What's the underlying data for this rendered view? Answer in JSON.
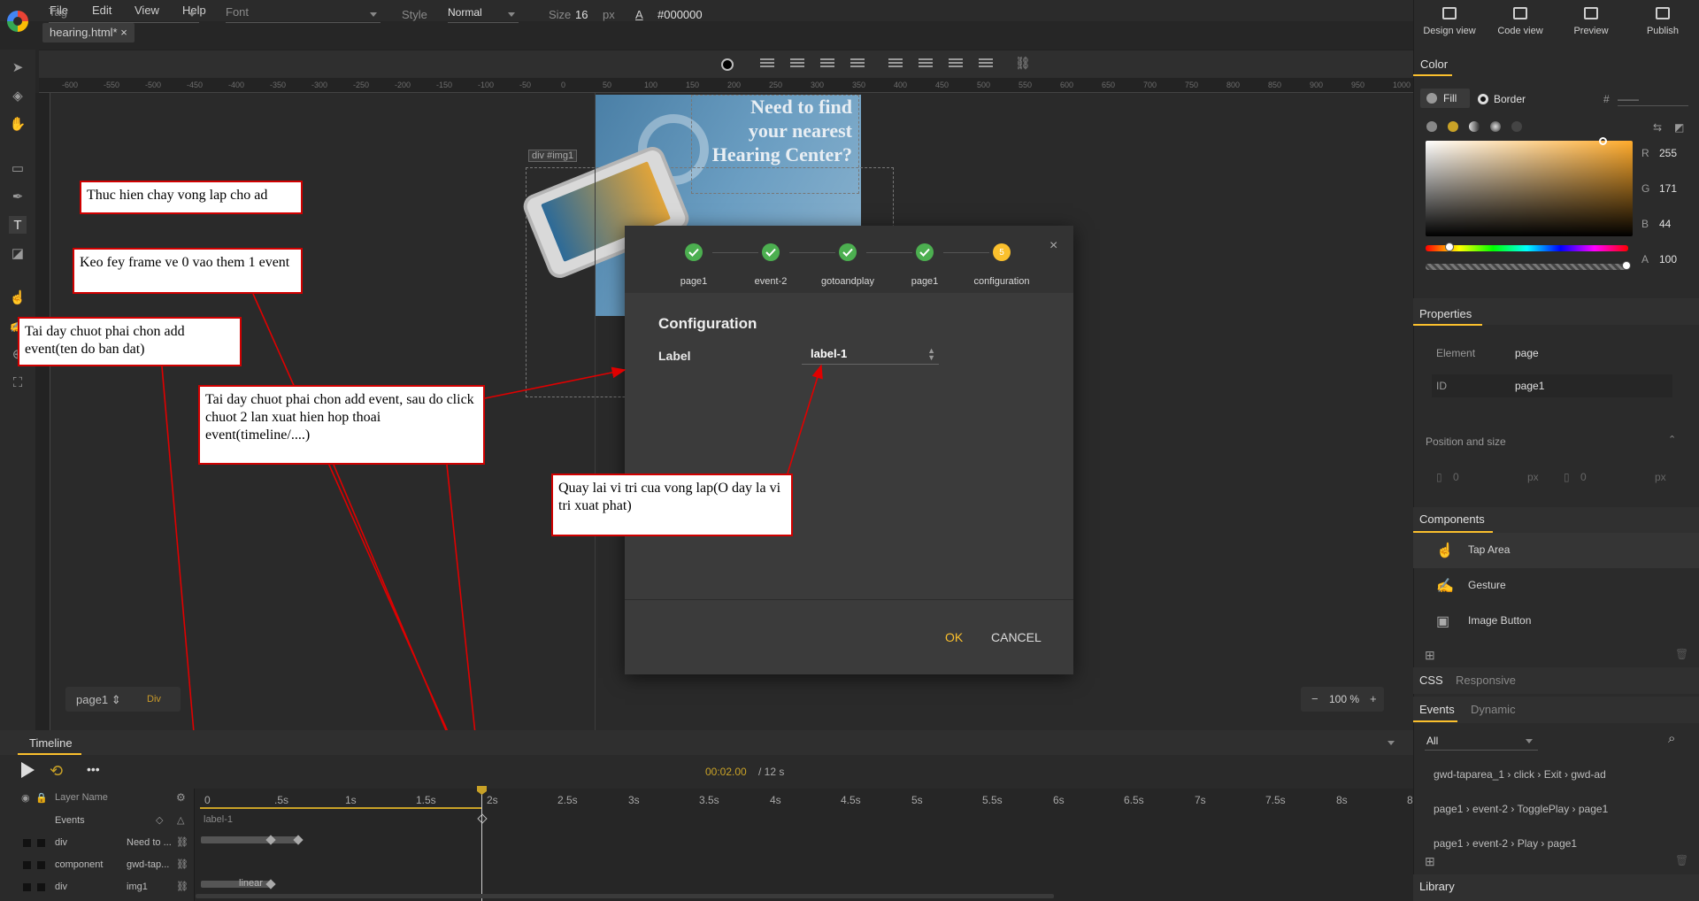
{
  "menu": {
    "items": [
      "File",
      "Edit",
      "View",
      "Help"
    ]
  },
  "document_tab": {
    "label": "hearing.html*",
    "close": "×"
  },
  "format_bar": {
    "tag_label": "Tag",
    "font_label": "Font",
    "style_label": "Style",
    "style_value": "Normal",
    "size_label": "Size",
    "size_value": "16",
    "size_unit": "px",
    "color_value": "#000000"
  },
  "ruler_top_ticks": [
    "-600",
    "-550",
    "-500",
    "-450",
    "-400",
    "-350",
    "-300",
    "-250",
    "-200",
    "-150",
    "-100",
    "-50",
    "0",
    "50",
    "100",
    "150",
    "200",
    "250",
    "300",
    "350",
    "400",
    "450",
    "500",
    "550",
    "600",
    "650",
    "700",
    "750",
    "800",
    "850",
    "900",
    "950",
    "1000"
  ],
  "stage": {
    "ad_text": [
      "Need to find",
      "your nearest",
      "Hearing Center?"
    ],
    "selection_tag": "div #img1",
    "page_selector": "page1 ⇕",
    "element_badge": "Div",
    "zoom_minus": "−",
    "zoom_value": "100 %",
    "zoom_plus": "+"
  },
  "annotations": {
    "n1": "Thuc hien chay vong lap cho ad",
    "n2": "Keo fey frame ve 0 vao them 1 event",
    "n3": "Tai day chuot phai chon add event(ten do ban dat)",
    "n4": "Tai day chuot phai chon add event, sau do click chuot 2 lan xuat hien hop thoai event(timeline/....)",
    "n5": "Quay lai vi tri cua vong lap(O day la vi tri xuat phat)"
  },
  "dialog": {
    "steps": [
      {
        "label": "page1",
        "state": "done"
      },
      {
        "label": "event-2",
        "state": "done"
      },
      {
        "label": "gotoandplay",
        "state": "done"
      },
      {
        "label": "page1",
        "state": "done"
      },
      {
        "label": "configuration",
        "state": "current",
        "number": "5"
      }
    ],
    "close": "×",
    "title": "Configuration",
    "field_label": "Label",
    "field_value": "label-1",
    "ok": "OK",
    "cancel": "CANCEL"
  },
  "right_panel": {
    "views": [
      "Design view",
      "Code view",
      "Preview",
      "Publish"
    ],
    "color_section": "Color",
    "fill": "Fill",
    "border": "Border",
    "hex_prefix": "#",
    "hex_value": "——",
    "rgba": {
      "R": "255",
      "G": "171",
      "B": "44",
      "A": "100"
    },
    "properties_section": "Properties",
    "element_label": "Element",
    "element_value": "page",
    "id_label": "ID",
    "id_value": "page1",
    "pos_size": "Position and size",
    "pos_x": "0",
    "pos_y": "0",
    "unit": "px",
    "components_section": "Components",
    "components": [
      "Tap Area",
      "Gesture",
      "Image Button"
    ],
    "tabs_a": [
      "CSS",
      "Responsive"
    ],
    "tabs_b": [
      "Events",
      "Dynamic"
    ],
    "events_filter": "All",
    "events": [
      "gwd-taparea_1 › click › Exit › gwd-ad",
      "page1 › event-2 › TogglePlay › page1",
      "page1 › event-2 › Play › page1"
    ],
    "library_section": "Library"
  },
  "timeline": {
    "title": "Timeline",
    "time_current": "00:02.00",
    "time_total": "/ 12 s",
    "layer_name_header": "Layer Name",
    "ticks": [
      "0",
      ".5s",
      "1s",
      "1.5s",
      "2s",
      "2.5s",
      "3s",
      "3.5s",
      "4s",
      "4.5s",
      "5s",
      "5.5s",
      "6s",
      "6.5s",
      "7s",
      "7.5s",
      "8s",
      "8"
    ],
    "layers": [
      {
        "name": "Events",
        "desc": ""
      },
      {
        "name": "div",
        "desc": "Need to ..."
      },
      {
        "name": "component",
        "desc": "gwd-tap..."
      },
      {
        "name": "div",
        "desc": "img1"
      }
    ],
    "event_label": "label-1",
    "easing": "linear"
  },
  "colors": {
    "accent": "#fbc02d",
    "annotation_border": "#d00000",
    "step_done": "#4caf50"
  }
}
